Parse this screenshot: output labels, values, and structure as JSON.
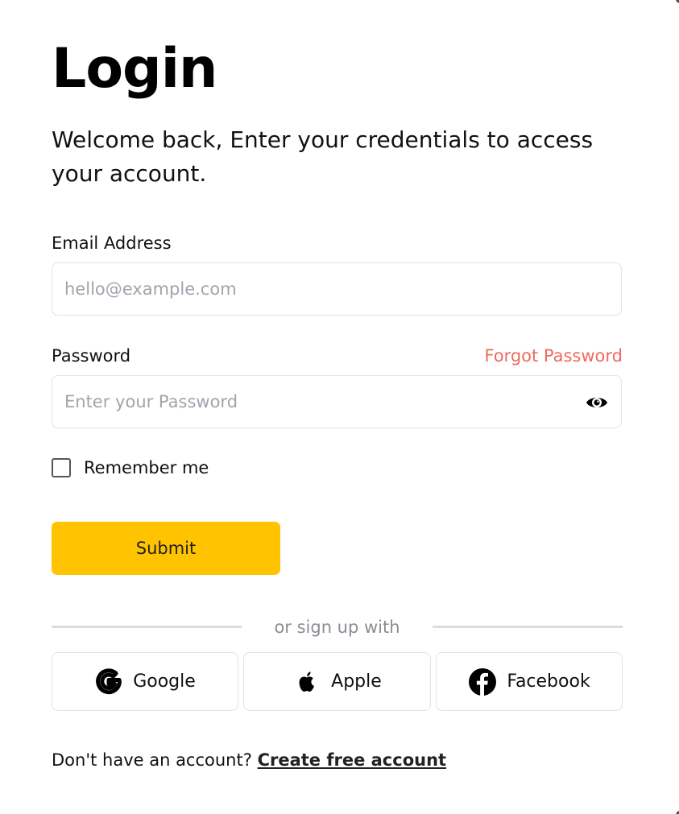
{
  "header": {
    "title": "Login",
    "subtitle": "Welcome back, Enter your credentials to access your account."
  },
  "form": {
    "email_label": "Email Address",
    "email_placeholder": "hello@example.com",
    "email_value": "",
    "password_label": "Password",
    "forgot_password": "Forgot Password",
    "password_placeholder": "Enter your Password",
    "password_value": "",
    "remember_me": "Remember me",
    "remember_checked": false,
    "submit_label": "Submit"
  },
  "social": {
    "divider": "or sign up with",
    "buttons": [
      {
        "label": "Google",
        "icon": "google-icon"
      },
      {
        "label": "Apple",
        "icon": "apple-icon"
      },
      {
        "label": "Facebook",
        "icon": "facebook-icon"
      }
    ]
  },
  "footer": {
    "prompt": "Don't have an account?",
    "link": "Create free account"
  },
  "colors": {
    "accent": "#ffc300",
    "forgot": "#ef6a5f",
    "placeholder": "#a3a3ad"
  }
}
